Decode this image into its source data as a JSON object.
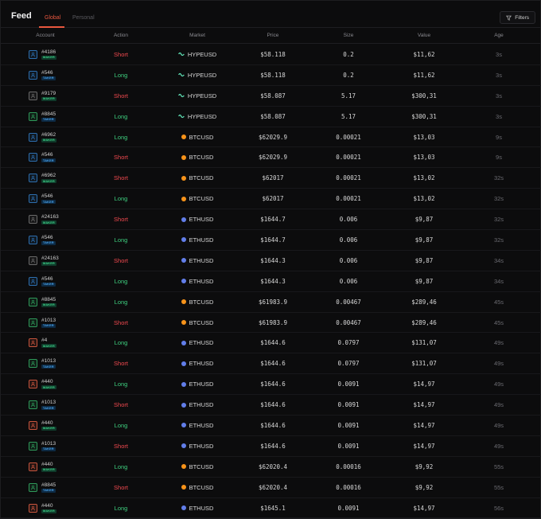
{
  "header": {
    "title": "Feed",
    "tabs": [
      {
        "label": "Global"
      },
      {
        "label": "Personal"
      }
    ],
    "filters_label": "Filters"
  },
  "columns": [
    "Account",
    "Action",
    "Market",
    "Price",
    "Size",
    "Value",
    "Age"
  ],
  "colors": {
    "maker_badge": "#3fd48a",
    "taker_badge": "#4ba6f0",
    "long": "#3ecf7f",
    "short": "#f0494f",
    "accent": "#e8573f",
    "btc": "#f7931a",
    "eth": "#627eea",
    "hype": "#5fe0b4"
  },
  "rows": [
    {
      "account": "#4186",
      "role": "MAKER",
      "avatar_color": "#2d6fb0",
      "action": "Short",
      "market": "HYPEUSD",
      "icon": "hype",
      "price": "$58.118",
      "size": "0.2",
      "value": "$11,62",
      "age": "3s"
    },
    {
      "account": "#546",
      "role": "TAKER",
      "avatar_color": "#2d6fb0",
      "action": "Long",
      "market": "HYPEUSD",
      "icon": "hype",
      "price": "$58.118",
      "size": "0.2",
      "value": "$11,62",
      "age": "3s"
    },
    {
      "account": "#9179",
      "role": "MAKER",
      "avatar_color": "#6a6a6a",
      "action": "Short",
      "market": "HYPEUSD",
      "icon": "hype",
      "price": "$58.087",
      "size": "5.17",
      "value": "$300,31",
      "age": "3s"
    },
    {
      "account": "#8845",
      "role": "TAKER",
      "avatar_color": "#2f9a5a",
      "action": "Long",
      "market": "HYPEUSD",
      "icon": "hype",
      "price": "$58.087",
      "size": "5.17",
      "value": "$300,31",
      "age": "3s"
    },
    {
      "account": "#6962",
      "role": "MAKER",
      "avatar_color": "#2d6fb0",
      "action": "Long",
      "market": "BTCUSD",
      "icon": "btc",
      "price": "$62029.9",
      "size": "0.00021",
      "value": "$13,03",
      "age": "9s"
    },
    {
      "account": "#546",
      "role": "TAKER",
      "avatar_color": "#2d6fb0",
      "action": "Short",
      "market": "BTCUSD",
      "icon": "btc",
      "price": "$62029.9",
      "size": "0.00021",
      "value": "$13,03",
      "age": "9s"
    },
    {
      "account": "#6962",
      "role": "MAKER",
      "avatar_color": "#2d6fb0",
      "action": "Short",
      "market": "BTCUSD",
      "icon": "btc",
      "price": "$62017",
      "size": "0.00021",
      "value": "$13,02",
      "age": "32s"
    },
    {
      "account": "#546",
      "role": "TAKER",
      "avatar_color": "#2d6fb0",
      "action": "Long",
      "market": "BTCUSD",
      "icon": "btc",
      "price": "$62017",
      "size": "0.00021",
      "value": "$13,02",
      "age": "32s"
    },
    {
      "account": "#24163",
      "role": "MAKER",
      "avatar_color": "#6a6a6a",
      "action": "Short",
      "market": "ETHUSD",
      "icon": "eth",
      "price": "$1644.7",
      "size": "0.006",
      "value": "$9,87",
      "age": "32s"
    },
    {
      "account": "#546",
      "role": "TAKER",
      "avatar_color": "#2d6fb0",
      "action": "Long",
      "market": "ETHUSD",
      "icon": "eth",
      "price": "$1644.7",
      "size": "0.006",
      "value": "$9,87",
      "age": "32s"
    },
    {
      "account": "#24163",
      "role": "MAKER",
      "avatar_color": "#6a6a6a",
      "action": "Short",
      "market": "ETHUSD",
      "icon": "eth",
      "price": "$1644.3",
      "size": "0.006",
      "value": "$9,87",
      "age": "34s"
    },
    {
      "account": "#546",
      "role": "TAKER",
      "avatar_color": "#2d6fb0",
      "action": "Long",
      "market": "ETHUSD",
      "icon": "eth",
      "price": "$1644.3",
      "size": "0.006",
      "value": "$9,87",
      "age": "34s"
    },
    {
      "account": "#8845",
      "role": "MAKER",
      "avatar_color": "#2f9a5a",
      "action": "Long",
      "market": "BTCUSD",
      "icon": "btc",
      "price": "$61983.9",
      "size": "0.00467",
      "value": "$289,46",
      "age": "45s"
    },
    {
      "account": "#1013",
      "role": "TAKER",
      "avatar_color": "#2f9a5a",
      "action": "Short",
      "market": "BTCUSD",
      "icon": "btc",
      "price": "$61983.9",
      "size": "0.00467",
      "value": "$289,46",
      "age": "45s"
    },
    {
      "account": "#4",
      "role": "MAKER",
      "avatar_color": "#c8553d",
      "action": "Long",
      "market": "ETHUSD",
      "icon": "eth",
      "price": "$1644.6",
      "size": "0.0797",
      "value": "$131,07",
      "age": "49s"
    },
    {
      "account": "#1013",
      "role": "TAKER",
      "avatar_color": "#2f9a5a",
      "action": "Short",
      "market": "ETHUSD",
      "icon": "eth",
      "price": "$1644.6",
      "size": "0.0797",
      "value": "$131,07",
      "age": "49s"
    },
    {
      "account": "#440",
      "role": "MAKER",
      "avatar_color": "#c8553d",
      "action": "Long",
      "market": "ETHUSD",
      "icon": "eth",
      "price": "$1644.6",
      "size": "0.0091",
      "value": "$14,97",
      "age": "49s"
    },
    {
      "account": "#1013",
      "role": "TAKER",
      "avatar_color": "#2f9a5a",
      "action": "Short",
      "market": "ETHUSD",
      "icon": "eth",
      "price": "$1644.6",
      "size": "0.0091",
      "value": "$14,97",
      "age": "49s"
    },
    {
      "account": "#440",
      "role": "MAKER",
      "avatar_color": "#c8553d",
      "action": "Long",
      "market": "ETHUSD",
      "icon": "eth",
      "price": "$1644.6",
      "size": "0.0091",
      "value": "$14,97",
      "age": "49s"
    },
    {
      "account": "#1013",
      "role": "TAKER",
      "avatar_color": "#2f9a5a",
      "action": "Short",
      "market": "ETHUSD",
      "icon": "eth",
      "price": "$1644.6",
      "size": "0.0091",
      "value": "$14,97",
      "age": "49s"
    },
    {
      "account": "#440",
      "role": "MAKER",
      "avatar_color": "#c8553d",
      "action": "Long",
      "market": "BTCUSD",
      "icon": "btc",
      "price": "$62020.4",
      "size": "0.00016",
      "value": "$9,92",
      "age": "55s"
    },
    {
      "account": "#8845",
      "role": "TAKER",
      "avatar_color": "#2f9a5a",
      "action": "Short",
      "market": "BTCUSD",
      "icon": "btc",
      "price": "$62020.4",
      "size": "0.00016",
      "value": "$9,92",
      "age": "55s"
    },
    {
      "account": "#440",
      "role": "MAKER",
      "avatar_color": "#c8553d",
      "action": "Long",
      "market": "ETHUSD",
      "icon": "eth",
      "price": "$1645.1",
      "size": "0.0091",
      "value": "$14,97",
      "age": "56s"
    }
  ]
}
